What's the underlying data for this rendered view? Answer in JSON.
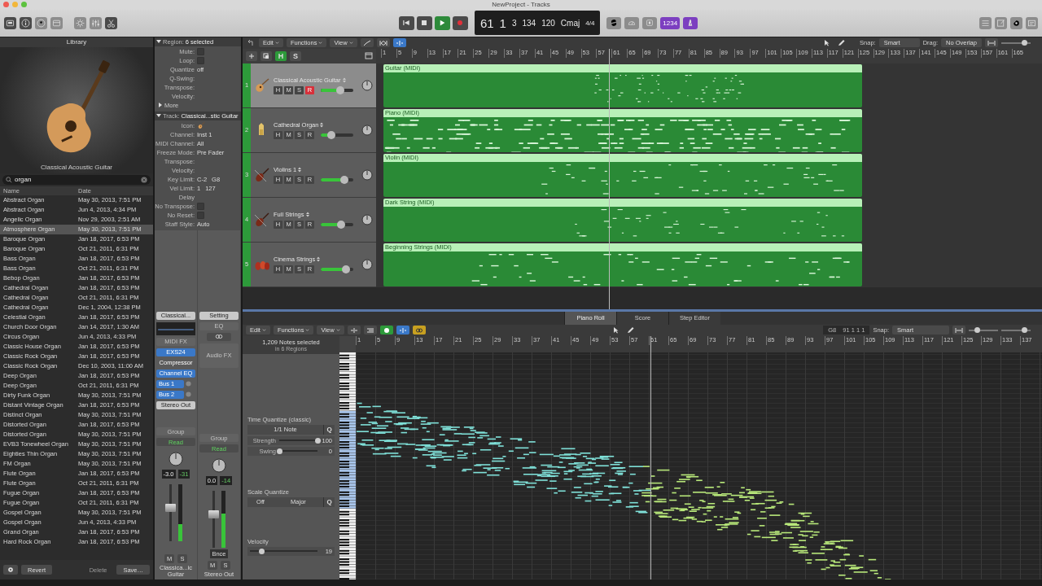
{
  "window": {
    "title": "NewProject - Tracks"
  },
  "toolbar": {
    "left_buttons": [
      {
        "kind": "library",
        "selected": true
      },
      {
        "kind": "info",
        "selected": true
      },
      {
        "kind": "help",
        "selected": false
      },
      {
        "kind": "toolbar",
        "selected": false
      },
      {
        "kind": "smart",
        "selected": false
      },
      {
        "kind": "mixer",
        "selected": false
      },
      {
        "kind": "scissors",
        "selected": true
      }
    ],
    "transport": [
      {
        "kind": "rewind",
        "selected": false
      },
      {
        "kind": "stop",
        "selected": false
      },
      {
        "kind": "play",
        "selected": true
      },
      {
        "kind": "record",
        "selected": false
      }
    ],
    "lcd": [
      {
        "kind": "big",
        "value": "61"
      },
      {
        "kind": "big",
        "value": "1"
      },
      {
        "kind": "mid",
        "value": "3"
      },
      {
        "kind": "mid",
        "value": "134"
      },
      {
        "kind": "mid",
        "value": "120"
      },
      {
        "kind": "mid",
        "value": "Cmaj"
      },
      {
        "kind": "small",
        "value": "4/4"
      }
    ],
    "mode_buttons": [
      {
        "kind": "cycle",
        "on": false
      },
      {
        "kind": "tuner",
        "on": false
      },
      {
        "kind": "solo",
        "on": false
      },
      {
        "kind": "count",
        "label": "1234",
        "on": true
      },
      {
        "kind": "metronome",
        "on": true
      }
    ],
    "right_buttons": [
      {
        "kind": "list"
      },
      {
        "kind": "notepad"
      },
      {
        "kind": "loops"
      },
      {
        "kind": "browser"
      }
    ]
  },
  "library": {
    "title": "Library",
    "caption": "Classical Acoustic Guitar",
    "search": {
      "value": "organ"
    },
    "columns": [
      "Name",
      "Date"
    ],
    "rows": [
      {
        "name": "Abstract Organ",
        "date": "May 30, 2013, 7:51 PM",
        "selected": false
      },
      {
        "name": "Abstract Organ",
        "date": "Jun 4, 2013, 4:34 PM",
        "selected": false
      },
      {
        "name": "Angelic Organ",
        "date": "Nov 29, 2003, 2:51 AM",
        "selected": false
      },
      {
        "name": "Atmosphere Organ",
        "date": "May 30, 2013, 7:51 PM",
        "selected": true
      },
      {
        "name": "Baroque Organ",
        "date": "Jan 18, 2017, 6:53 PM",
        "selected": false
      },
      {
        "name": "Baroque Organ",
        "date": "Oct 21, 2011, 6:31 PM",
        "selected": false
      },
      {
        "name": "Bass Organ",
        "date": "Jan 18, 2017, 6:53 PM",
        "selected": false
      },
      {
        "name": "Bass Organ",
        "date": "Oct 21, 2011, 6:31 PM",
        "selected": false
      },
      {
        "name": "Bebop Organ",
        "date": "Jan 18, 2017, 6:53 PM",
        "selected": false
      },
      {
        "name": "Cathedral Organ",
        "date": "Jan 18, 2017, 6:53 PM",
        "selected": false
      },
      {
        "name": "Cathedral Organ",
        "date": "Oct 21, 2011, 6:31 PM",
        "selected": false
      },
      {
        "name": "Cathedral Organ",
        "date": "Dec 1, 2004, 12:38 PM",
        "selected": false
      },
      {
        "name": "Celestial Organ",
        "date": "Jan 18, 2017, 6:53 PM",
        "selected": false
      },
      {
        "name": "Church Door Organ",
        "date": "Jan 14, 2017, 1:30 AM",
        "selected": false
      },
      {
        "name": "Circus Organ",
        "date": "Jun 4, 2013, 4:33 PM",
        "selected": false
      },
      {
        "name": "Classic House Organ",
        "date": "Jan 18, 2017, 6:53 PM",
        "selected": false
      },
      {
        "name": "Classic Rock Organ",
        "date": "Jan 18, 2017, 6:53 PM",
        "selected": false
      },
      {
        "name": "Classic Rock Organ",
        "date": "Dec 10, 2003, 11:00 AM",
        "selected": false
      },
      {
        "name": "Deep Organ",
        "date": "Jan 18, 2017, 6:53 PM",
        "selected": false
      },
      {
        "name": "Deep Organ",
        "date": "Oct 21, 2011, 6:31 PM",
        "selected": false
      },
      {
        "name": "Dirty Funk Organ",
        "date": "May 30, 2013, 7:51 PM",
        "selected": false
      },
      {
        "name": "Distant Vintage Organ",
        "date": "Jan 18, 2017, 6:53 PM",
        "selected": false
      },
      {
        "name": "Distinct Organ",
        "date": "May 30, 2013, 7:51 PM",
        "selected": false
      },
      {
        "name": "Distorted Organ",
        "date": "Jan 18, 2017, 6:53 PM",
        "selected": false
      },
      {
        "name": "Distorted Organ",
        "date": "May 30, 2013, 7:51 PM",
        "selected": false
      },
      {
        "name": "EVB3 Tonewheel Organ",
        "date": "May 30, 2013, 7:51 PM",
        "selected": false
      },
      {
        "name": "Eighties Thin Organ",
        "date": "May 30, 2013, 7:51 PM",
        "selected": false
      },
      {
        "name": "FM Organ",
        "date": "May 30, 2013, 7:51 PM",
        "selected": false
      },
      {
        "name": "Flute Organ",
        "date": "Jan 18, 2017, 6:53 PM",
        "selected": false
      },
      {
        "name": "Flute Organ",
        "date": "Oct 21, 2011, 6:31 PM",
        "selected": false
      },
      {
        "name": "Fugue Organ",
        "date": "Jan 18, 2017, 6:53 PM",
        "selected": false
      },
      {
        "name": "Fugue Organ",
        "date": "Oct 21, 2011, 6:31 PM",
        "selected": false
      },
      {
        "name": "Gospel Organ",
        "date": "May 30, 2013, 7:51 PM",
        "selected": false
      },
      {
        "name": "Gospel Organ",
        "date": "Jun 4, 2013, 4:33 PM",
        "selected": false
      },
      {
        "name": "Grand Organ",
        "date": "Jan 18, 2017, 6:53 PM",
        "selected": false
      },
      {
        "name": "Hard Rock Organ",
        "date": "Jan 18, 2017, 6:53 PM",
        "selected": false
      }
    ],
    "buttons": [
      {
        "label": "Revert",
        "disabled": false
      },
      {
        "label": "Delete",
        "disabled": true
      },
      {
        "label": "Save…",
        "disabled": false
      }
    ]
  },
  "inspector": {
    "region": {
      "title": "Region:",
      "value": "6 selected",
      "more": "More",
      "fields": [
        {
          "label": "Mute:",
          "kind": "checkbox",
          "checked": false
        },
        {
          "label": "Loop:",
          "kind": "checkbox",
          "checked": false
        },
        {
          "label": "Quantize",
          "kind": "popup",
          "value": "off"
        },
        {
          "label": "Q-Swing:",
          "kind": "text"
        },
        {
          "label": "Transpose:",
          "kind": "popup"
        },
        {
          "label": "Velocity:",
          "kind": "text"
        }
      ]
    },
    "track": {
      "title": "Track:",
      "value": "Classical...stic Guitar",
      "fields": [
        {
          "label": "Icon:",
          "kind": "icon"
        },
        {
          "label": "Channel:",
          "kind": "popup",
          "value": "Inst 1"
        },
        {
          "label": "MIDI Channel:",
          "kind": "popup",
          "value": "All"
        },
        {
          "label": "Freeze Mode:",
          "kind": "popup",
          "value": "Pre Fader"
        },
        {
          "label": "Transpose:",
          "kind": "popup"
        },
        {
          "label": "Velocity:",
          "kind": "text"
        },
        {
          "label": "Key Limit:",
          "kind": "pair",
          "value": "C-2",
          "value2": "G8"
        },
        {
          "label": "Vel Limit:",
          "kind": "pair",
          "value": "1",
          "value2": "127"
        },
        {
          "label": "Delay",
          "kind": "text"
        },
        {
          "label": "No Transpose:",
          "kind": "checkbox",
          "checked": false
        },
        {
          "label": "No Reset:",
          "kind": "checkbox",
          "checked": false
        },
        {
          "label": "Staff Style:",
          "kind": "popup",
          "value": "Auto"
        }
      ]
    },
    "strips": [
      {
        "slots": [
          {
            "kind": "button",
            "label": "Classical..."
          },
          {
            "kind": "eq"
          },
          {
            "kind": "dim",
            "label": "MIDI FX"
          },
          {
            "kind": "plugin",
            "label": "EXS24"
          },
          {
            "kind": "plain",
            "label": "Compressor"
          },
          {
            "kind": "plugin",
            "label": "Channel EQ"
          },
          {
            "kind": "send",
            "label": "Bus 1"
          },
          {
            "kind": "send",
            "label": "Bus 2"
          },
          {
            "kind": "button",
            "label": "Stereo Out"
          },
          {
            "kind": "group",
            "label": "Group"
          },
          {
            "kind": "read",
            "label": "Read"
          }
        ],
        "volume": "-3.0",
        "peak": "-31",
        "fader": {
          "level": 0.58
        },
        "meter": {
          "level": 0.3
        },
        "mute": "M",
        "solo": "S",
        "name": "Classica...ic Guitar"
      },
      {
        "slots": [
          {
            "kind": "button",
            "label": "Setting"
          },
          {
            "kind": "dim",
            "label": "EQ"
          },
          {
            "kind": "link"
          },
          {
            "kind": "tall",
            "label": "Audio FX"
          },
          {
            "kind": "group",
            "label": "Group"
          },
          {
            "kind": "read",
            "label": "Read"
          }
        ],
        "volume": "0.0",
        "peak": "-14",
        "fader": {
          "level": 0.58
        },
        "meter": {
          "level": 0.6
        },
        "bounce": "Bnce",
        "mute": "M",
        "solo": "S",
        "name": "Stereo Out"
      }
    ]
  },
  "tracks_area": {
    "menus": [
      "Edit",
      "Functions",
      "View"
    ],
    "snap_label": "Snap:",
    "snap": "Smart",
    "drag_label": "Drag:",
    "drag": "No Overlap",
    "header_buttons": [
      {
        "label": "H",
        "on": true
      },
      {
        "label": "S",
        "on": false
      }
    ],
    "ruler": [
      "1",
      "5",
      "9",
      "13",
      "17",
      "21",
      "25",
      "29",
      "33",
      "37",
      "41",
      "45",
      "49",
      "53",
      "57",
      "61",
      "65",
      "69",
      "73",
      "77",
      "81",
      "85",
      "89",
      "93",
      "97",
      "101",
      "105",
      "109",
      "113",
      "117",
      "121",
      "125",
      "129",
      "133",
      "137",
      "141",
      "145",
      "149",
      "153",
      "157",
      "161",
      "165"
    ],
    "zoom": {
      "level": 0.78
    },
    "tracks": [
      {
        "number": "1",
        "name": "Classical Acoustic Guitar",
        "kind": "guitar",
        "selected": true,
        "buttons": [
          "H",
          "M",
          "S"
        ],
        "record": "R",
        "armed": true,
        "volume": {
          "level": 0.6
        },
        "region": "Guitar (MIDI)"
      },
      {
        "number": "2",
        "name": "Cathedral Organ",
        "kind": "organ",
        "selected": false,
        "buttons": [
          "H",
          "M",
          "S"
        ],
        "record": "R",
        "armed": false,
        "volume": {
          "level": 0.33
        },
        "region": "Piano (MIDI)"
      },
      {
        "number": "3",
        "name": "Violins 1",
        "kind": "violin",
        "selected": false,
        "buttons": [
          "H",
          "M",
          "S"
        ],
        "record": "R",
        "armed": false,
        "volume": {
          "level": 0.73
        },
        "region": "Violin (MIDI)"
      },
      {
        "number": "4",
        "name": "Full Strings",
        "kind": "violin",
        "selected": false,
        "buttons": [
          "H",
          "M",
          "S"
        ],
        "record": "R",
        "armed": false,
        "volume": {
          "level": 0.62
        },
        "region": "Dark String (MIDI)"
      },
      {
        "number": "5",
        "name": "Cinema Strings",
        "kind": "ensemble",
        "selected": false,
        "buttons": [
          "H",
          "M",
          "S"
        ],
        "record": "R",
        "armed": false,
        "volume": {
          "level": 0.78
        },
        "region": "Beginning Strings (MIDI)"
      }
    ]
  },
  "editor": {
    "tabs": [
      {
        "label": "Piano Roll",
        "selected": true
      },
      {
        "label": "Score",
        "selected": false
      },
      {
        "label": "Step Editor",
        "selected": false
      }
    ],
    "menus": [
      "Edit",
      "Functions",
      "View"
    ],
    "position": [
      "G8",
      "91 1 1 1"
    ],
    "zoom": [
      {
        "level": 0.3
      },
      {
        "level": 0.8
      }
    ],
    "snap_label": "Snap:",
    "snap": "Smart",
    "selection": "1,209 Notes selected",
    "selection_sub": "in 6 Regions",
    "time_quantize": {
      "title": "Time Quantize (classic)",
      "value": "1/1 Note",
      "q": "Q",
      "strength_label": "Strength",
      "strength": {
        "level": 1
      },
      "strength_value": "100",
      "swing_label": "Swing",
      "swing": {
        "level": 0
      },
      "swing_value": "0"
    },
    "scale_quantize": {
      "title": "Scale Quantize",
      "root": "Off",
      "scale": "Major",
      "q": "Q"
    },
    "velocity": {
      "title": "Velocity",
      "slider": {
        "level": 0.17
      },
      "value": "19"
    },
    "ruler": [
      "1",
      "5",
      "9",
      "13",
      "17",
      "21",
      "25",
      "29",
      "33",
      "37",
      "41",
      "45",
      "49",
      "53",
      "57",
      "61",
      "65",
      "69",
      "73",
      "77",
      "81",
      "85",
      "89",
      "93",
      "97",
      "101",
      "105",
      "109",
      "113",
      "117",
      "121",
      "125",
      "129",
      "133",
      "137"
    ]
  }
}
